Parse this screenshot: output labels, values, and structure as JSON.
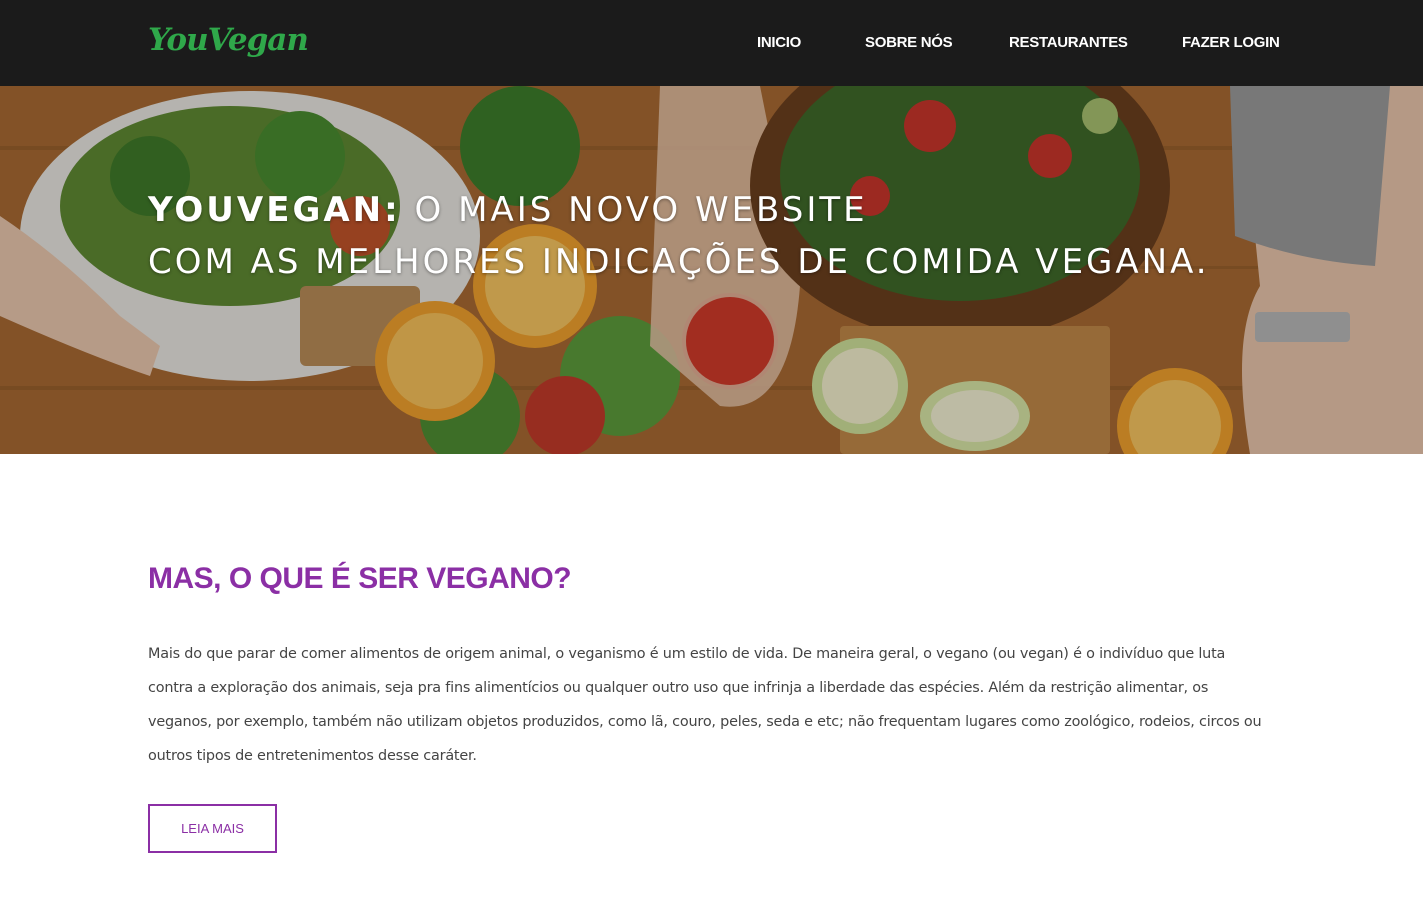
{
  "brand": {
    "logo": "YouVegan",
    "logo_color": "#2fa84a"
  },
  "nav": {
    "items": [
      {
        "label": "INICIO"
      },
      {
        "label": "SOBRE NÓS"
      },
      {
        "label": "RESTAURANTES"
      },
      {
        "label": "FAZER LOGIN"
      }
    ]
  },
  "hero": {
    "title_strong": "YOUVEGAN:",
    "title_rest": " O MAIS NOVO WEBSITE",
    "title_line2": "COM AS MELHORES INDICAÇÕES DE COMIDA VEGANA."
  },
  "about": {
    "heading": "MAS, O QUE É SER VEGANO?",
    "heading_color": "#8b2fa5",
    "body": "Mais do que parar de comer alimentos de origem animal, o veganismo é um estilo de vida. De maneira geral, o vegano (ou vegan) é o indivíduo que luta contra a exploração dos animais, seja pra fins alimentícios ou qualquer outro uso que infrinja a liberdade das espécies. Além da restrição alimentar, os veganos, por exemplo, também não utilizam objetos produzidos, como lã, couro, peles, seda e etc; não frequentam lugares como zoológico, rodeios, circos ou outros tipos de entretenimentos desse caráter.",
    "button_label": "LEIA MAIS"
  }
}
